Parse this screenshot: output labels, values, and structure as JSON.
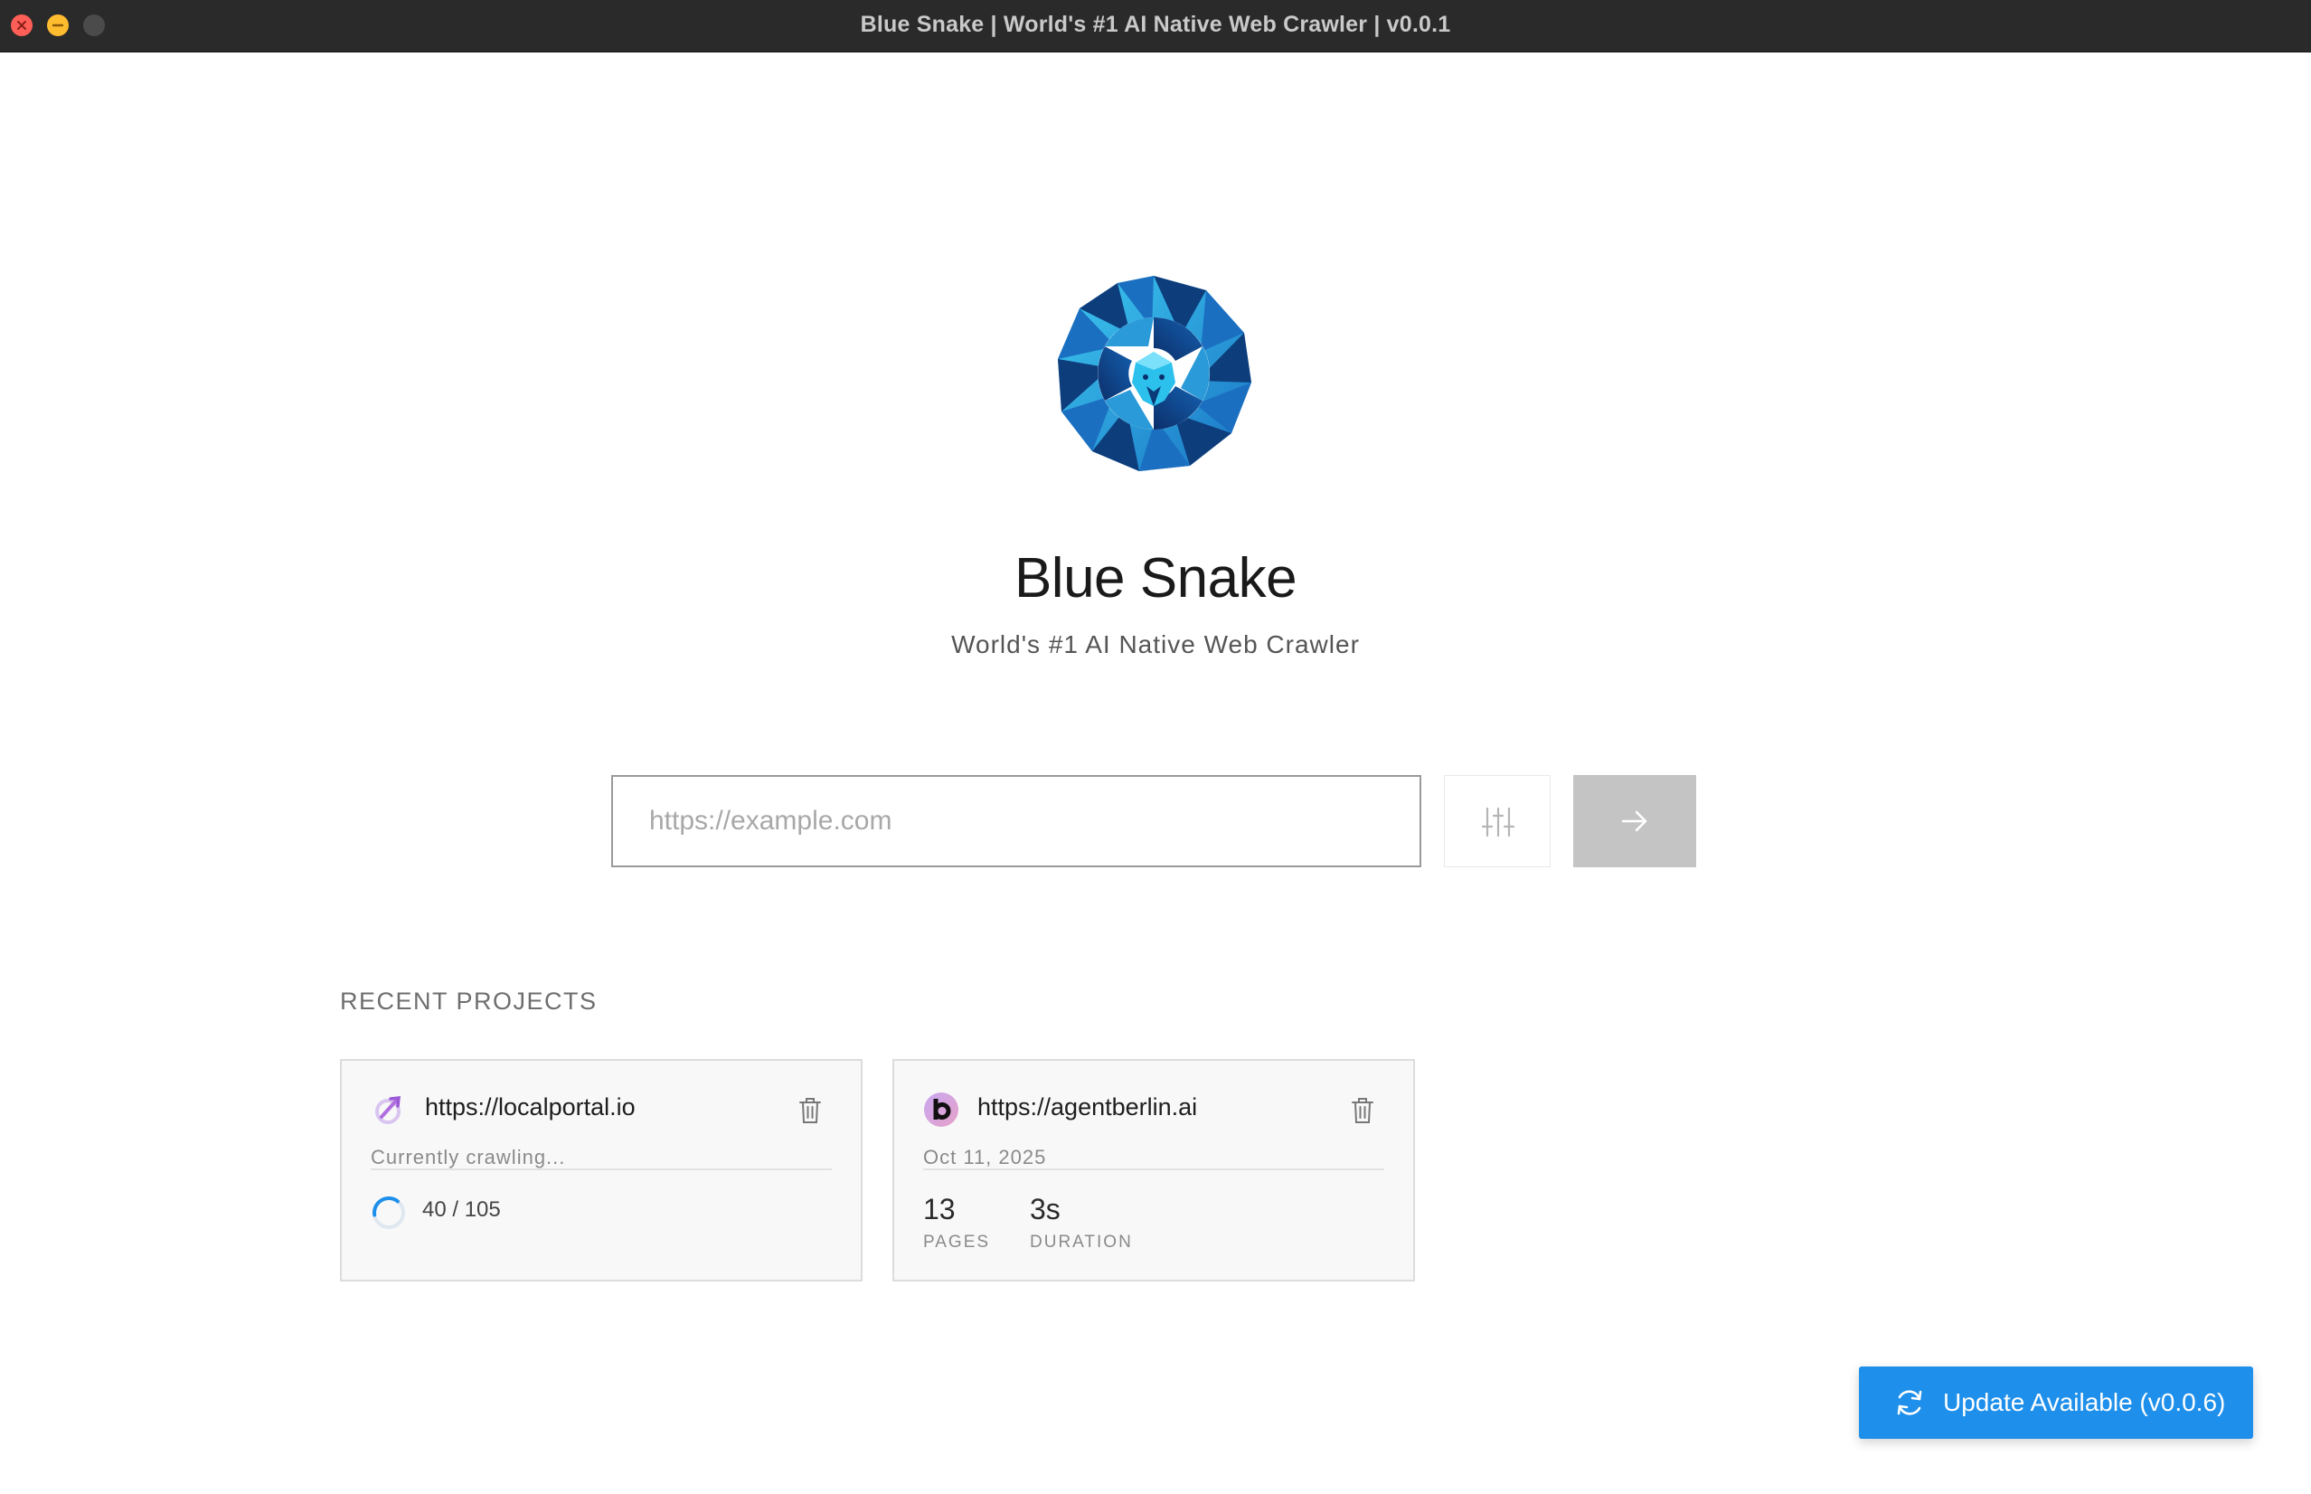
{
  "window": {
    "title": "Blue Snake | World's #1 AI Native Web Crawler | v0.0.1"
  },
  "hero": {
    "logo_icon": "blue-snake-logo",
    "app_name": "Blue Snake",
    "tagline": "World's #1 AI Native Web Crawler"
  },
  "crawl_form": {
    "url_placeholder": "https://example.com",
    "url_value": "",
    "settings_icon": "sliders-icon",
    "submit_icon": "arrow-right-icon"
  },
  "recent": {
    "section_label": "RECENT PROJECTS",
    "projects": [
      {
        "url": "https://localportal.io",
        "status": "Currently crawling...",
        "progress": "40 / 105",
        "progress_fraction": 0.381,
        "favicon": "localportal-favicon"
      },
      {
        "url": "https://agentberlin.ai",
        "date": "Oct 11, 2025",
        "pages_value": "13",
        "pages_label": "PAGES",
        "duration_value": "3s",
        "duration_label": "DURATION",
        "favicon": "agentberlin-favicon"
      }
    ]
  },
  "update": {
    "label": "Update Available (v0.0.6)",
    "icon": "refresh-icon"
  },
  "colors": {
    "accent": "#1e8fea",
    "logo_dark": "#0d3f7a",
    "logo_light": "#2cc0ec"
  }
}
